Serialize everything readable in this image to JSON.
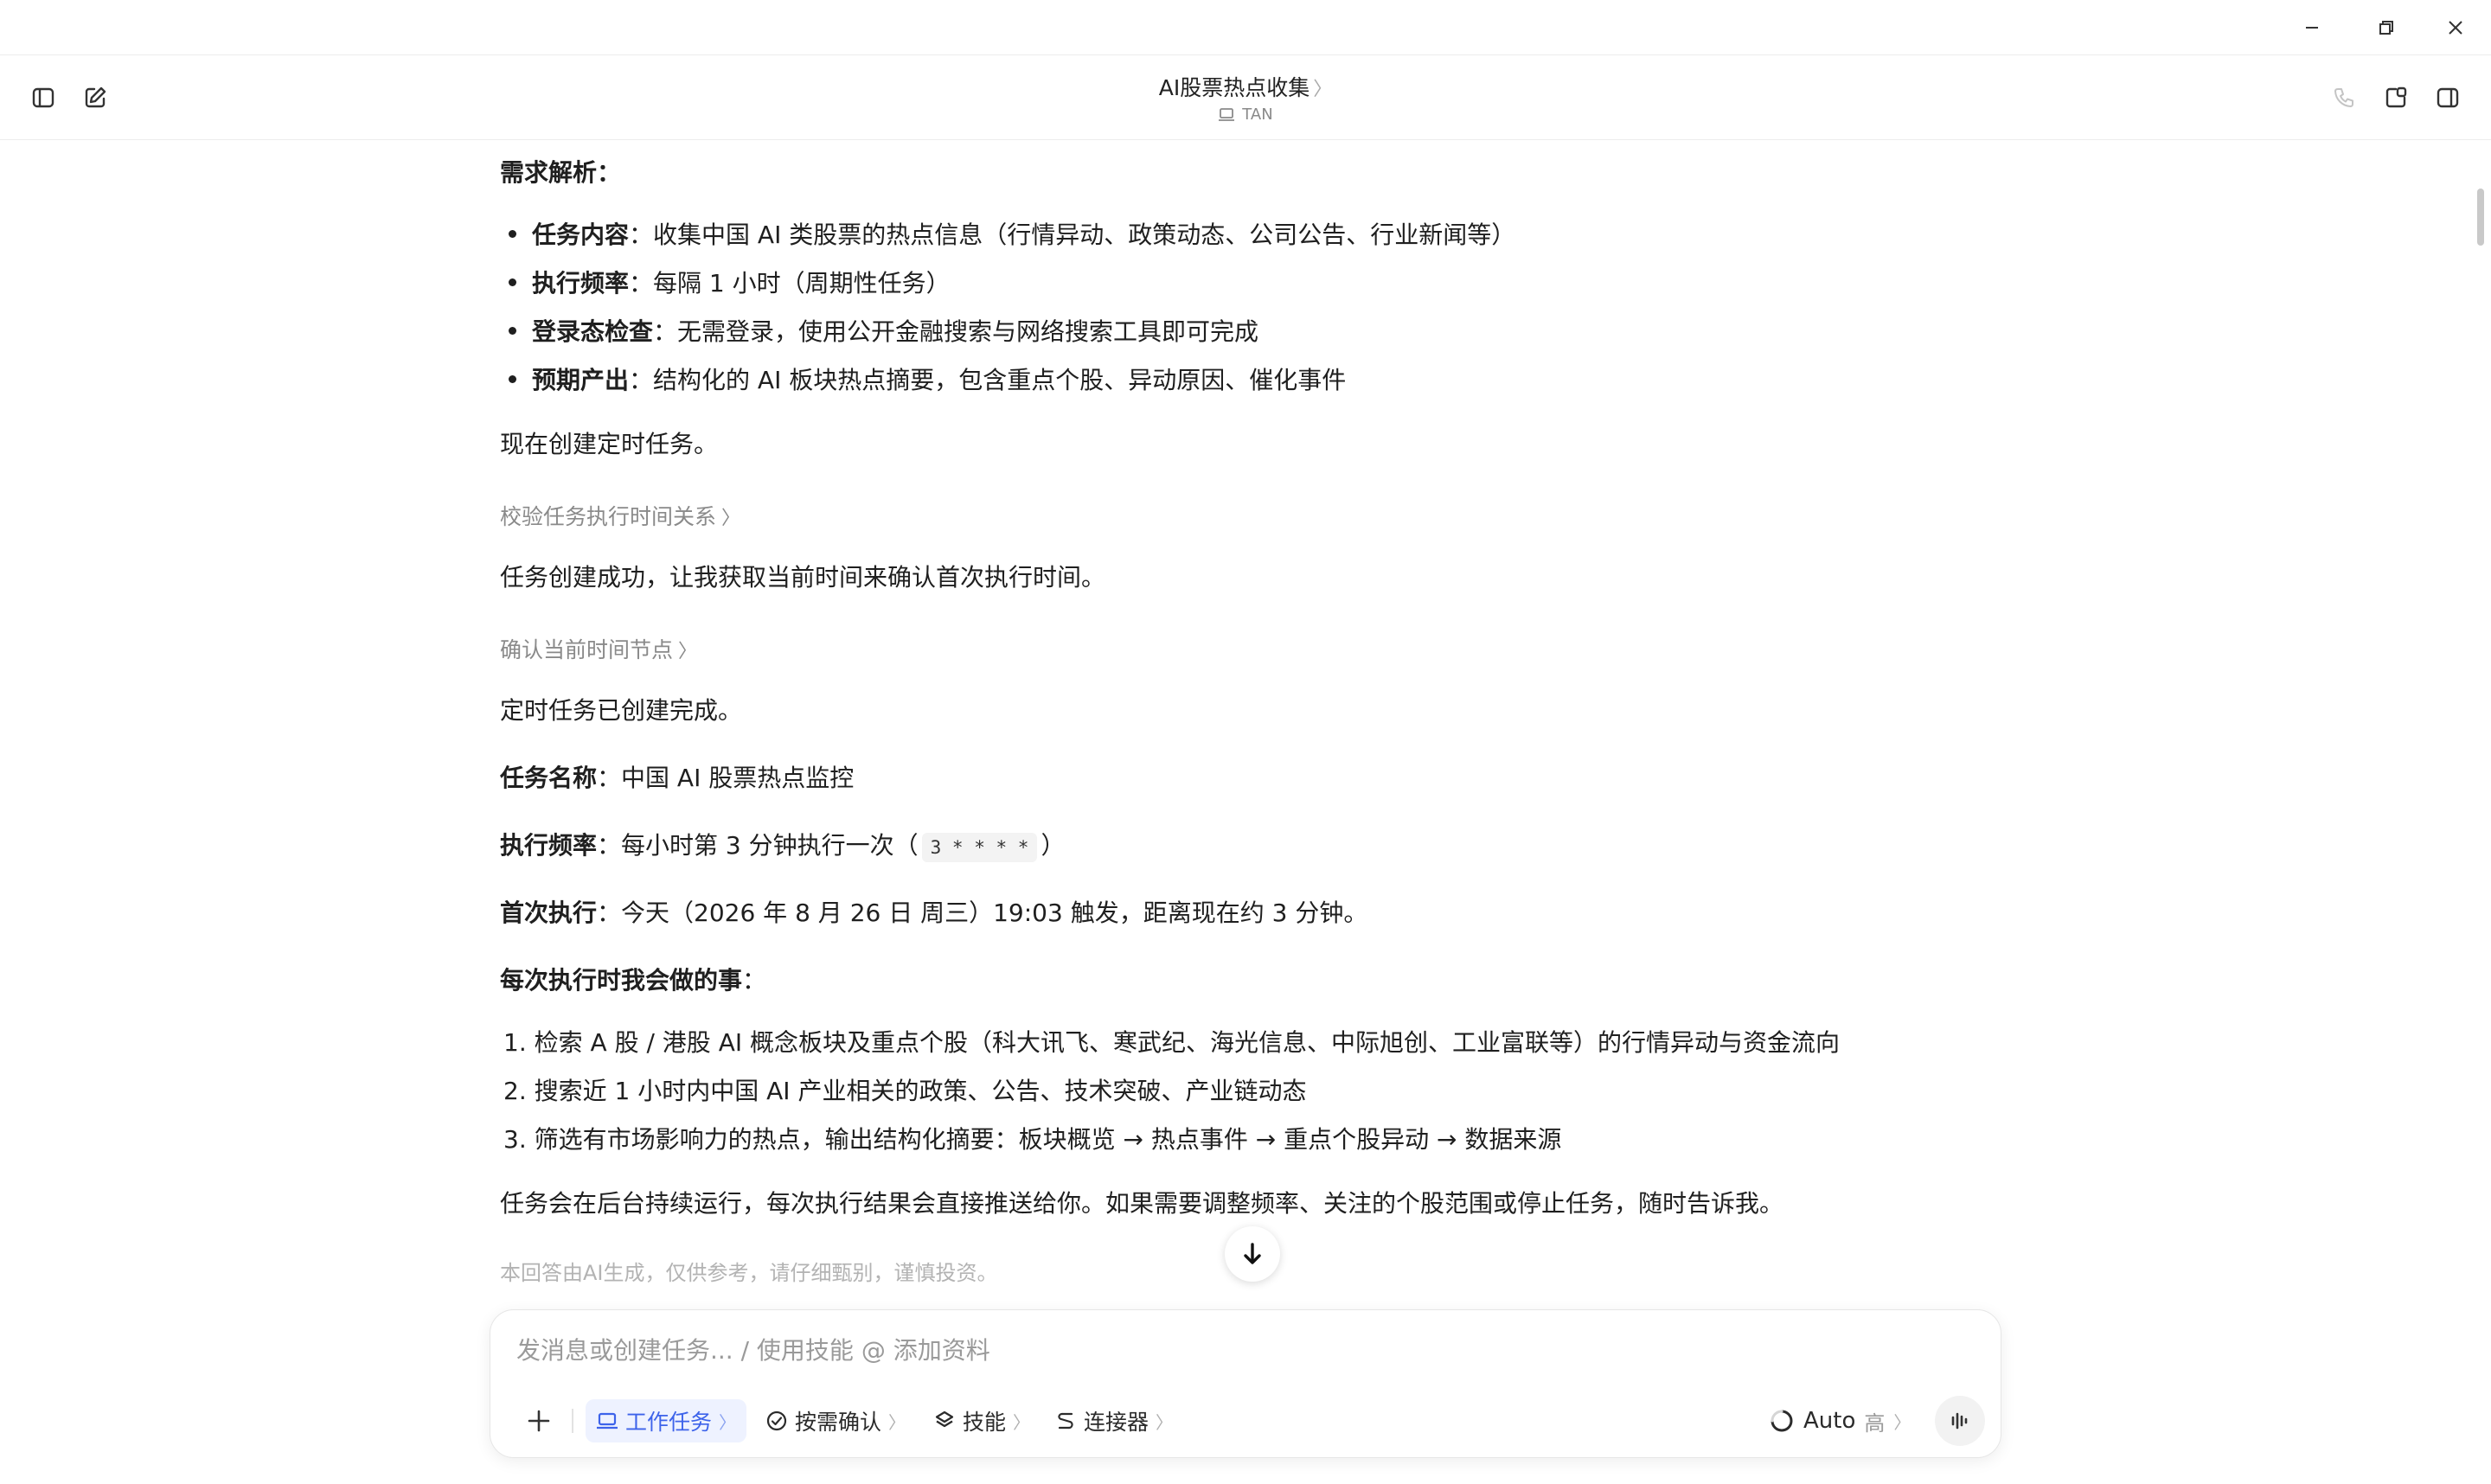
{
  "window": {
    "minimize_icon": "minimize-icon",
    "restore_icon": "restore-icon",
    "close_icon": "close-icon"
  },
  "header": {
    "title": "AI股票热点收集",
    "title_chevron": "〉",
    "workspace": "TAN"
  },
  "intro_heading": "需求解析：",
  "requirements": [
    {
      "label": "任务内容",
      "text": "：收集中国 AI 类股票的热点信息（行情异动、政策动态、公司公告、行业新闻等）"
    },
    {
      "label": "执行频率",
      "text": "：每隔 1 小时（周期性任务）"
    },
    {
      "label": "登录态检查",
      "text": "：无需登录，使用公开金融搜索与网络搜索工具即可完成"
    },
    {
      "label": "预期产出",
      "text": "：结构化的 AI 板块热点摘要，包含重点个股、异动原因、催化事件"
    }
  ],
  "create_line": "现在创建定时任务。",
  "step1": "校验任务执行时间关系",
  "step1_chevron": "〉",
  "created_line": "任务创建成功，让我获取当前时间来确认首次执行时间。",
  "step2": "确认当前时间节点",
  "step2_chevron": "〉",
  "done_line": "定时任务已创建完成。",
  "task_name": {
    "label": "任务名称",
    "text": "：中国 AI 股票热点监控"
  },
  "frequency": {
    "label": "执行频率",
    "before": "：每小时第 3 分钟执行一次（",
    "code": "3 * * * *",
    "after": "）"
  },
  "first_run": {
    "label": "首次执行",
    "text": "：今天（2026 年 8 月 26 日 周三）19:03 触发，距离现在约 3 分钟。"
  },
  "each_run": {
    "label": "每次执行时我会做的事",
    "colon": "："
  },
  "actions": [
    "1. 检索 A 股 / 港股 AI 概念板块及重点个股（科大讯飞、寒武纪、海光信息、中际旭创、工业富联等）的行情异动与资金流向",
    "2. 搜索近 1 小时内中国 AI 产业相关的政策、公告、技术突破、产业链动态",
    "3. 筛选有市场影响力的热点，输出结构化摘要：板块概览 → 热点事件 → 重点个股异动 → 数据来源"
  ],
  "closing": "任务会在后台持续运行，每次执行结果会直接推送给你。如果需要调整频率、关注的个股范围或停止任务，随时告诉我。",
  "disclaimer": "本回答由AI生成，仅供参考，请仔细甄别，谨慎投资。",
  "composer": {
    "placeholder": "发消息或创建任务... / 使用技能 @ 添加资料",
    "chips": [
      {
        "label": "工作任务",
        "icon": "laptop-icon"
      },
      {
        "label": "按需确认",
        "icon": "check-circle-icon"
      },
      {
        "label": "技能",
        "icon": "layers-icon"
      },
      {
        "label": "连接器",
        "icon": "link-icon"
      }
    ],
    "chevron": "〉",
    "model": "Auto",
    "level": "高"
  },
  "colors": {
    "accent": "#3d63ea",
    "accent_bg": "#eef2ff",
    "muted": "#8a8a8a"
  }
}
